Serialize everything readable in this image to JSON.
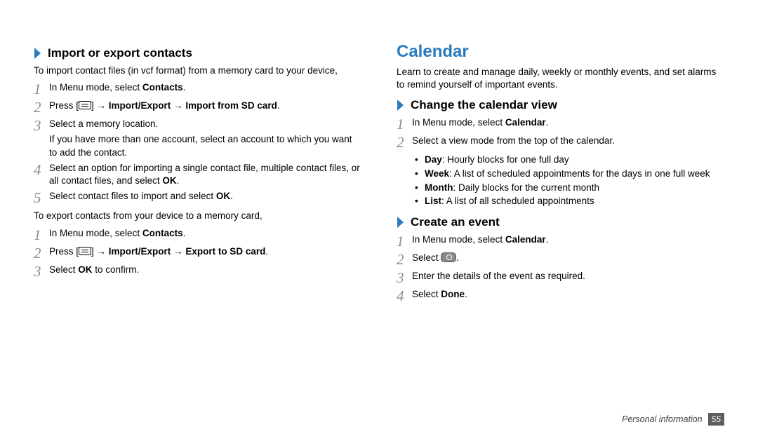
{
  "left": {
    "subhead1": "Import or export contacts",
    "intro1": "To import contact files (in vcf format) from a memory card to your device,",
    "s1_1_a": "In Menu mode, select ",
    "s1_1_b": "Contacts",
    "s1_1_c": ".",
    "s1_2_a": "Press [",
    "s1_2_b": "] → ",
    "s1_2_c": "Import/Export",
    "s1_2_d": " → ",
    "s1_2_e": "Import from SD card",
    "s1_2_f": ".",
    "s1_3": "Select a memory location.",
    "s1_3_indent": "If you have more than one account, select an account to which you want to add the contact.",
    "s1_4_a": "Select an option for importing a single contact file, multiple contact files, or all contact files, and select ",
    "s1_4_b": "OK",
    "s1_4_c": ".",
    "s1_5_a": "Select contact files to import and select ",
    "s1_5_b": "OK",
    "s1_5_c": ".",
    "intro2": "To export contacts from your device to a memory card,",
    "s2_1_a": "In Menu mode, select ",
    "s2_1_b": "Contacts",
    "s2_1_c": ".",
    "s2_2_a": "Press [",
    "s2_2_b": "] → ",
    "s2_2_c": "Import/Export",
    "s2_2_d": " → ",
    "s2_2_e": "Export to SD card",
    "s2_2_f": ".",
    "s2_3_a": "Select ",
    "s2_3_b": "OK",
    "s2_3_c": " to confirm."
  },
  "right": {
    "title": "Calendar",
    "intro": "Learn to create and manage daily, weekly or monthly events, and set alarms to remind yourself of important events.",
    "subhead1": "Change the calendar view",
    "c1_1_a": "In Menu mode, select ",
    "c1_1_b": "Calendar",
    "c1_1_c": ".",
    "c1_2": "Select a view mode from the top of the calendar.",
    "b1_a": "Day",
    "b1_b": ": Hourly blocks for one full day",
    "b2_a": "Week",
    "b2_b": ": A list of scheduled appointments for the days in one full week",
    "b3_a": "Month",
    "b3_b": ": Daily blocks for the current month",
    "b4_a": "List",
    "b4_b": ": A list of all scheduled appointments",
    "subhead2": "Create an event",
    "e1_a": "In Menu mode, select ",
    "e1_b": "Calendar",
    "e1_c": ".",
    "e2_a": "Select ",
    "e2_b": ".",
    "e3": "Enter the details of the event as required.",
    "e4_a": "Select ",
    "e4_b": "Done",
    "e4_c": "."
  },
  "footer": {
    "section": "Personal information",
    "page": "55"
  },
  "nums": {
    "n1": "1",
    "n2": "2",
    "n3": "3",
    "n4": "4",
    "n5": "5"
  }
}
